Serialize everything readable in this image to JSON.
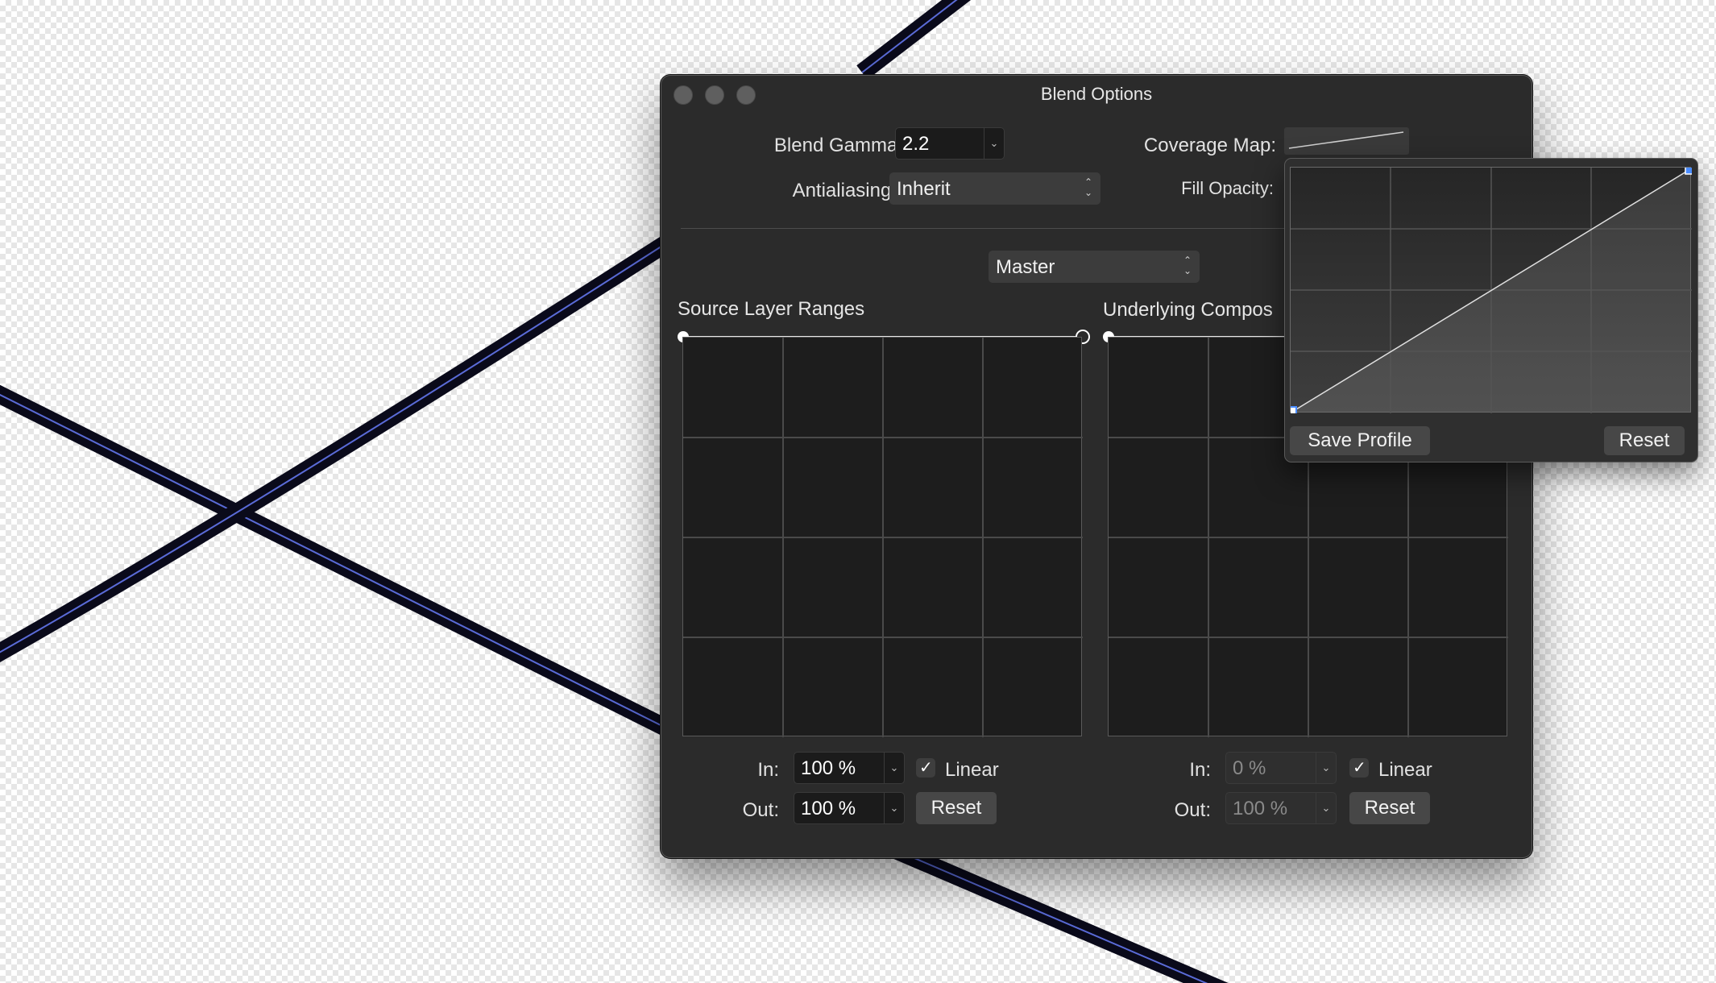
{
  "window": {
    "title": "Blend Options"
  },
  "top": {
    "blend_gamma_label": "Blend Gamma:",
    "blend_gamma_value": "2.2",
    "antialiasing_label": "Antialiasing:",
    "antialiasing_value": "Inherit",
    "coverage_map_label": "Coverage Map:",
    "fill_opacity_label": "Fill Opacity:"
  },
  "channel": {
    "value": "Master"
  },
  "source": {
    "title": "Source Layer Ranges",
    "in_label": "In:",
    "in_value": "100 %",
    "out_label": "Out:",
    "out_value": "100 %",
    "linear_label": "Linear",
    "linear_checked": true,
    "reset_label": "Reset"
  },
  "underlying": {
    "title": "Underlying Compos",
    "in_label": "In:",
    "in_value": "0 %",
    "out_label": "Out:",
    "out_value": "100 %",
    "linear_label": "Linear",
    "linear_checked": true,
    "reset_label": "Reset"
  },
  "coverage_popover": {
    "save_profile_label": "Save Profile",
    "reset_label": "Reset"
  },
  "icons": {
    "check": "✓",
    "chevron_down": "⌄",
    "updown_up": "⌃",
    "updown_down": "⌄"
  },
  "colors": {
    "window_bg": "#2b2b2b",
    "stroke_outer": "#0a0a1a",
    "stroke_inner": "#5a6bd8",
    "handle_blue": "#4a8cff"
  }
}
